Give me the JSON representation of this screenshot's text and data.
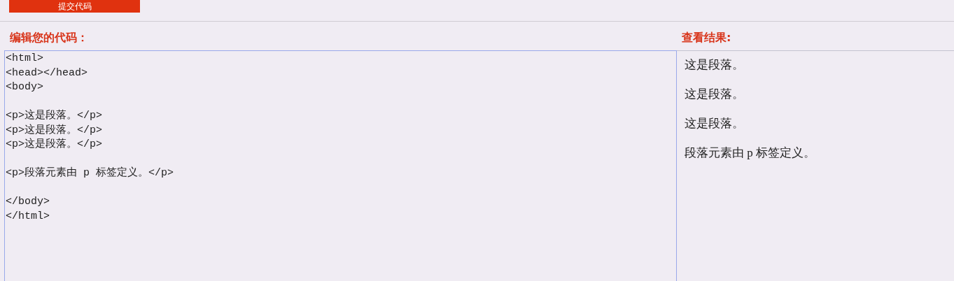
{
  "submit_button": {
    "label": "提交代码"
  },
  "editor": {
    "title": "编辑您的代码：",
    "code": "<html>\n<head></head>\n<body>\n\n<p>这是段落。</p>\n<p>这是段落。</p>\n<p>这是段落。</p>\n\n<p>段落元素由 p 标签定义。</p>\n\n</body>\n</html>"
  },
  "result": {
    "title": "查看结果:",
    "paragraphs": [
      "这是段落。",
      "这是段落。",
      "这是段落。",
      "段落元素由 p 标签定义。"
    ]
  }
}
